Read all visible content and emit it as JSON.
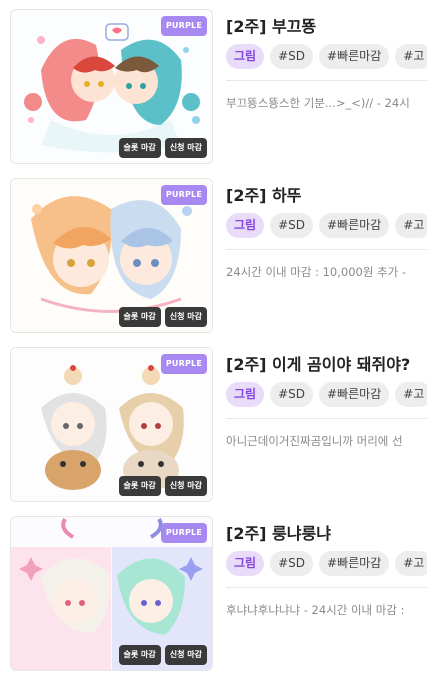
{
  "listings": [
    {
      "title": "[2주] 부끄뚕",
      "tier_badge": "PURPLE",
      "badges": [
        "슬롯 마감",
        "신청 마감"
      ],
      "tags": [
        "그림",
        "#SD",
        "#빠른마감",
        "#고"
      ],
      "description": "부끄뚕스뚕스한 기분...>_<)// - 24시"
    },
    {
      "title": "[2주] 하뚜",
      "tier_badge": "PURPLE",
      "badges": [
        "슬롯 마감",
        "신청 마감"
      ],
      "tags": [
        "그림",
        "#SD",
        "#빠른마감",
        "#고"
      ],
      "description": "24시간 이내 마감 : 10,000원 추가 -"
    },
    {
      "title": "[2주] 이게 곰이야 돼쥐야?",
      "tier_badge": "PURPLE",
      "badges": [
        "슬롯 마감",
        "신청 마감"
      ],
      "tags": [
        "그림",
        "#SD",
        "#빠른마감",
        "#고"
      ],
      "description": "아니근데이거진짜곰입니까 머리에 선"
    },
    {
      "title": "[2주] 룽냐룽냐",
      "tier_badge": "PURPLE",
      "badges": [
        "슬롯 마감",
        "신청 마감"
      ],
      "tags": [
        "그림",
        "#SD",
        "#빠른마감",
        "#고"
      ],
      "description": "후냐냐후냐냐냐 - 24시간 이내 마감 :"
    }
  ],
  "colors": {
    "accent_purple": "#a889f2",
    "tag_primary_bg": "#e8dcf9",
    "tag_primary_text": "#8546e0",
    "badge_dark": "#3a3a3a"
  }
}
